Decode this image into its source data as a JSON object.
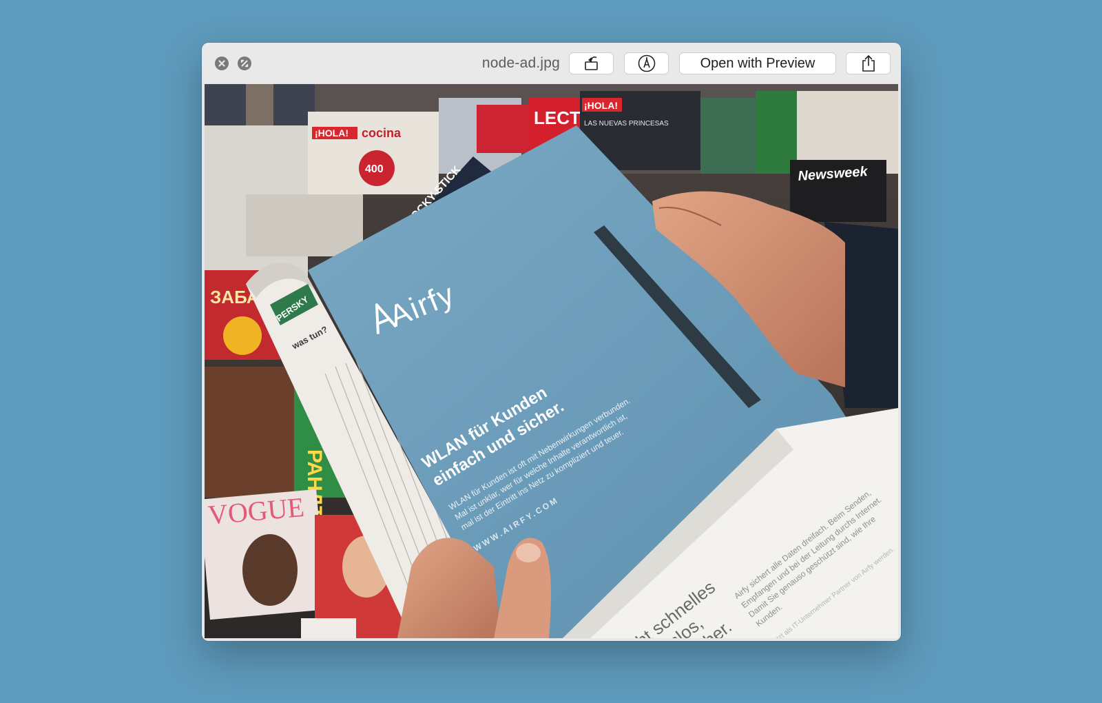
{
  "window": {
    "filename": "node-ad.jpg",
    "open_button_label": "Open with Preview"
  },
  "icons": {
    "close": "close-icon",
    "fullscreen": "fullscreen-icon",
    "rotate": "rotate-icon",
    "markup": "markup-icon",
    "share": "share-icon"
  },
  "photo": {
    "brand": "Airfy",
    "headline_line1": "WLAN für Kunden",
    "headline_line2": "einfach und sicher.",
    "body_line1": "WLAN für Kunden ist oft mit Nebenwirkungen verbunden.",
    "body_line2": "Mal ist unklar, wer für welche Inhalte verantwortlich ist,",
    "body_line3": "mal ist der Eintritt ins Netz zu kompliziert und teuer.",
    "url": "WWW.AIRFY.COM",
    "flap_line1": "Airfy sichert alle Daten dreifach. Beim Senden,",
    "flap_line2": "Empfangen und bei der Leitung durchs Internet.",
    "flap_line3": "Damit Sie genauso geschützt sind, wie Ihre",
    "flap_line4": "Kunden.",
    "flap_small": "Jetzt als IT-Unternehmer Partner von Airfy werden.",
    "flap_big1": "acht schnelles",
    "flap_big2": "tenlos,",
    "flap_big3": "cher.",
    "sticker": "LOCKY-STICK",
    "roll_title": "was tun?",
    "roll_sticker": "PERSKY",
    "mag_hola1": "¡HOLA!",
    "mag_cocina": "cocina",
    "mag_400": "400",
    "mag_lectu": "LECTU",
    "mag_hola2": "¡HOLA!",
    "mag_princesas": "LAS NUEVAS PRINCESAS",
    "mag_newsweek": "Newsweek",
    "mag_vogue": "VOGUE",
    "mag_zaba": "ЗАБА",
    "mag_randt": "РАНДТ"
  }
}
